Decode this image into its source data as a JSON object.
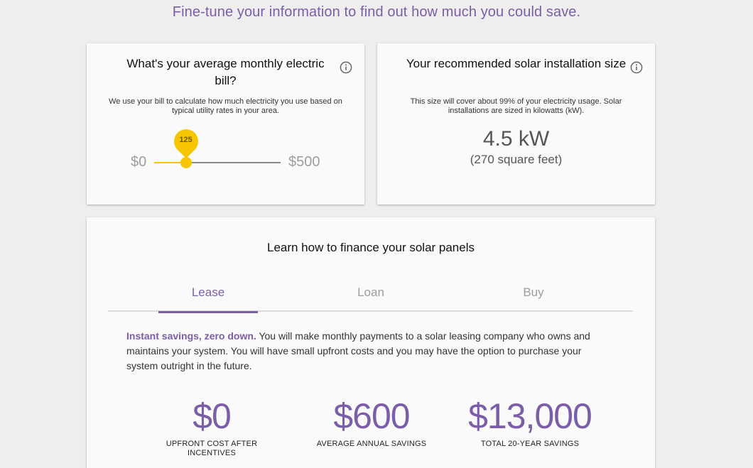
{
  "headline": "Fine-tune your information to find out how much you could save.",
  "bill_card": {
    "title": "What's your average monthly electric bill?",
    "description": "We use your bill to calculate how much electricity you use based on typical utility rates in your area.",
    "slider": {
      "min_label": "$0",
      "max_label": "$500",
      "min": 0,
      "max": 500,
      "value": 125,
      "value_label": "125",
      "accent_color": "#f7c600"
    },
    "info_icon": "info-icon"
  },
  "size_card": {
    "title": "Your recommended solar installation size",
    "description": "This size will cover about 99% of your electricity usage. Solar installations are sized in kilowatts (kW).",
    "value": "4.5 kW",
    "sub_value": "(270 square feet)",
    "info_icon": "info-icon"
  },
  "finance": {
    "title": "Learn how to finance your solar panels",
    "tabs": [
      {
        "label": "Lease",
        "active": true
      },
      {
        "label": "Loan",
        "active": false
      },
      {
        "label": "Buy",
        "active": false
      }
    ],
    "lead": "Instant savings, zero down.",
    "body": " You will make monthly payments to a solar leasing company who owns and maintains your system. You will have small upfront costs and you may have the option to purchase your system outright in the future.",
    "stats": [
      {
        "value": "$0",
        "label": "UPFRONT COST AFTER INCENTIVES"
      },
      {
        "value": "$600",
        "label": "AVERAGE ANNUAL SAVINGS"
      },
      {
        "value": "$13,000",
        "label": "TOTAL 20-YEAR SAVINGS"
      }
    ]
  },
  "colors": {
    "accent": "#7b5ea7",
    "slider": "#f7c600",
    "background": "#eeeeee",
    "card": "#fafafa"
  }
}
